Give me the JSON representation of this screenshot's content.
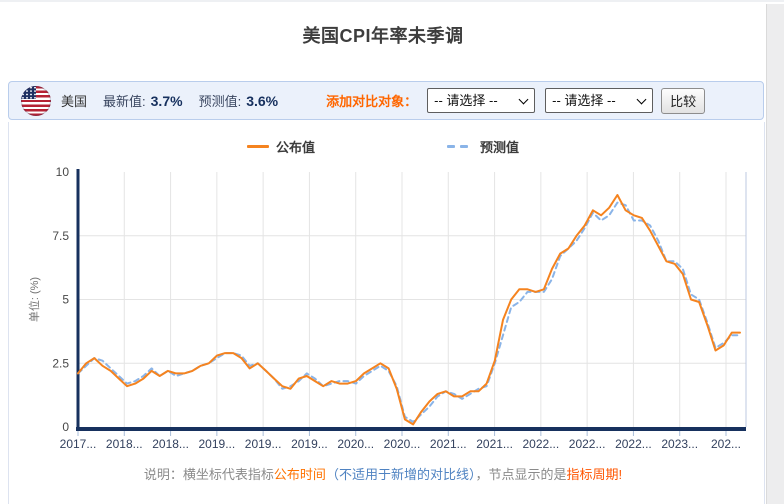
{
  "page": {
    "title": "美国CPI年率未季调"
  },
  "info_bar": {
    "country": "美国",
    "flag_icon": "us-flag",
    "latest_label": "最新值:",
    "latest_value": "3.7%",
    "forecast_label": "预测值:",
    "forecast_value": "3.6%",
    "compare_label": "添加对比对象：",
    "select1_value": "-- 请选择 --",
    "select2_value": "-- 请选择 --",
    "compare_button": "比较"
  },
  "footer": {
    "prefix": "说明：横坐标代表指标",
    "publish_time": "公布时间",
    "paren": "（不适用于新增的对比线）",
    "mid": "，节点显示的是",
    "period": "指标周期!"
  },
  "colors": {
    "published_line": "#f5831f",
    "forecast_line": "#8ab4e8",
    "axis": "#17315e",
    "grid": "#e4e4e4",
    "accent_orange": "#ff6600",
    "info_bar_bg": "#ebf1fb",
    "info_bar_border": "#b9cdec"
  },
  "chart_data": {
    "type": "line",
    "title": "美国CPI年率未季调",
    "xlabel": "",
    "ylabel": "单位: (%)",
    "ylim": [
      0,
      10
    ],
    "yticks": [
      0,
      2.5,
      5,
      7.5,
      10
    ],
    "grid": true,
    "legend_position": "top-center",
    "x_tick_labels": [
      "2017...",
      "2018...",
      "2018...",
      "2019...",
      "2019...",
      "2019...",
      "2020...",
      "2020...",
      "2021...",
      "2021...",
      "2022...",
      "2022...",
      "2022...",
      "2023...",
      "202..."
    ],
    "axis_color": "#17315e",
    "series": [
      {
        "name": "公布值",
        "color": "#f5831f",
        "style": "solid",
        "values": [
          2.1,
          2.5,
          2.7,
          2.4,
          2.2,
          1.9,
          1.6,
          1.7,
          1.9,
          2.2,
          2.0,
          2.2,
          2.1,
          2.1,
          2.2,
          2.4,
          2.5,
          2.8,
          2.9,
          2.9,
          2.7,
          2.3,
          2.5,
          2.2,
          1.9,
          1.6,
          1.5,
          1.9,
          2.0,
          1.8,
          1.6,
          1.8,
          1.7,
          1.7,
          1.8,
          2.1,
          2.3,
          2.5,
          2.3,
          1.5,
          0.3,
          0.1,
          0.6,
          1.0,
          1.3,
          1.4,
          1.2,
          1.2,
          1.4,
          1.4,
          1.7,
          2.6,
          4.2,
          5.0,
          5.4,
          5.4,
          5.3,
          5.4,
          6.2,
          6.8,
          7.0,
          7.5,
          7.9,
          8.5,
          8.3,
          8.6,
          9.1,
          8.5,
          8.3,
          8.2,
          7.7,
          7.1,
          6.5,
          6.4,
          6.0,
          5.0,
          4.9,
          4.0,
          3.0,
          3.2,
          3.7,
          3.7
        ]
      },
      {
        "name": "预测值",
        "color": "#8ab4e8",
        "style": "dashed",
        "dash": "5,4",
        "values": [
          2.1,
          2.4,
          2.7,
          2.6,
          2.3,
          2.0,
          1.7,
          1.8,
          2.0,
          2.3,
          2.0,
          2.2,
          2.0,
          2.1,
          2.2,
          2.4,
          2.5,
          2.7,
          2.9,
          2.9,
          2.8,
          2.4,
          2.5,
          2.2,
          1.9,
          1.5,
          1.6,
          1.8,
          2.1,
          1.9,
          1.6,
          1.7,
          1.8,
          1.8,
          1.7,
          2.0,
          2.2,
          2.4,
          2.2,
          1.6,
          0.4,
          0.2,
          0.5,
          0.8,
          1.2,
          1.4,
          1.3,
          1.1,
          1.3,
          1.5,
          1.6,
          2.5,
          3.6,
          4.7,
          4.9,
          5.3,
          5.3,
          5.3,
          5.8,
          6.7,
          7.0,
          7.3,
          7.8,
          8.4,
          8.1,
          8.3,
          8.8,
          8.7,
          8.1,
          8.1,
          7.9,
          7.3,
          6.5,
          6.5,
          6.2,
          5.2,
          5.0,
          4.1,
          3.1,
          3.3,
          3.6,
          3.6
        ]
      }
    ]
  }
}
